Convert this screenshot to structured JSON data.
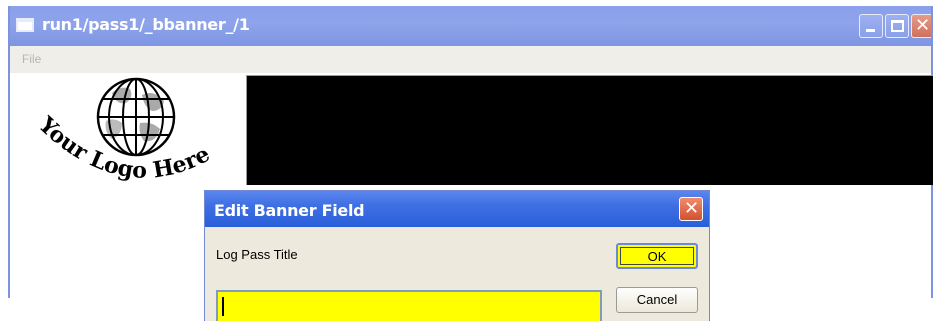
{
  "window": {
    "title": "run1/pass1/_bbanner_/1",
    "controls": [
      "minimize-icon",
      "maximize-icon",
      "close-icon"
    ]
  },
  "menubar": {
    "items": [
      {
        "label": "File",
        "enabled": false
      }
    ]
  },
  "logo": {
    "text": "Your Logo Here",
    "icon": "globe-icon"
  },
  "banner": {
    "background": "#000000"
  },
  "dialog": {
    "title": "Edit Banner Field",
    "label": "Log Pass Title",
    "input": {
      "value": "",
      "background": "#ffff00"
    },
    "ok_label": "OK",
    "cancel_label": "Cancel",
    "close_glyph": "✕"
  },
  "colors": {
    "titlebar": "#8ea3ea",
    "dialog_titlebar": "#2a5fd9",
    "highlight": "#ffff00"
  }
}
